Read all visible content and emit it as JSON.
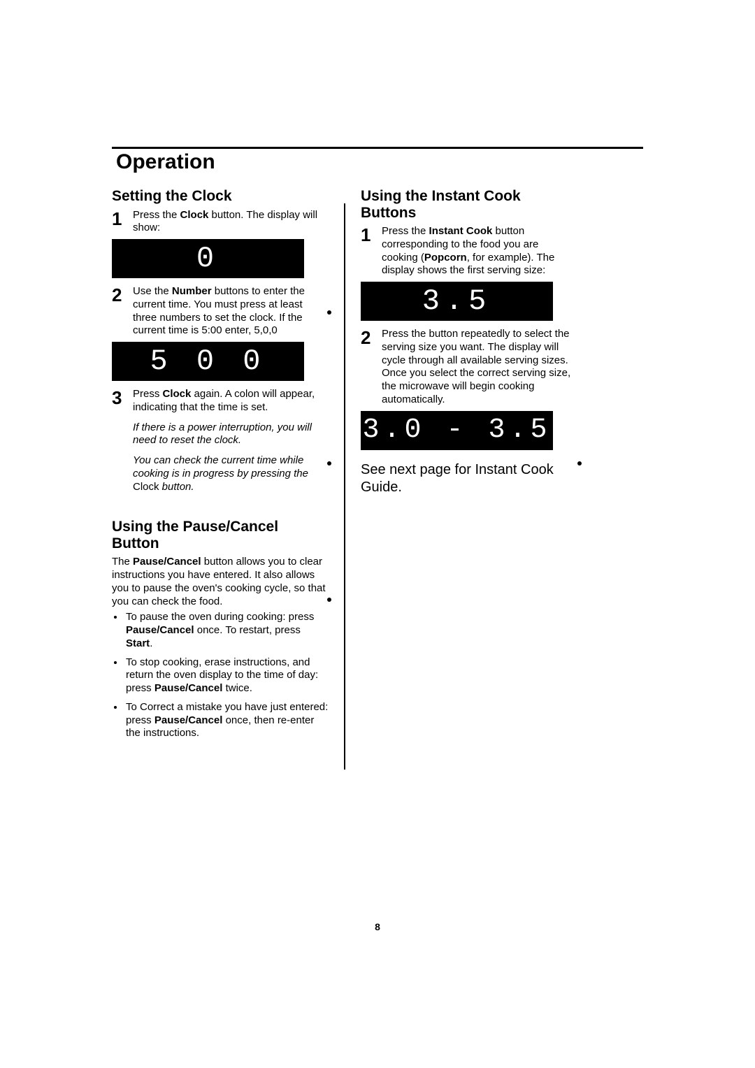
{
  "title": "Operation",
  "page_number": "8",
  "left": {
    "sec1_heading": "Setting the Clock",
    "step1_num": "1",
    "step1_a": "Press the ",
    "step1_clock": "Clock",
    "step1_b": " button. The display will show:",
    "display1": "0",
    "step2_num": "2",
    "step2_a": "Use the ",
    "step2_number": "Number",
    "step2_b": " buttons to enter the current time. You must press at least three numbers to set the clock. If the current time is 5:00 enter, 5,0,0",
    "display2": "5 0 0",
    "step3_num": "3",
    "step3_a": "Press ",
    "step3_clock": "Clock",
    "step3_b": " again. A colon will appear, indicating that the time is set.",
    "step3_note1": "If there is a power interruption, you will need to reset the clock.",
    "step3_note2": "You can check the current time while cooking is in progress by pressing the",
    "step3_note2_clock": "Clock",
    "step3_note2_tail": "  button.",
    "sec2_heading": "Using the Pause/Cancel Button",
    "sec2_intro_a": "The ",
    "sec2_intro_pc": "Pause/Cancel",
    "sec2_intro_b": " button allows you to clear instructions you have entered.  It also allows you to pause the oven's cooking cycle, so that you can check the food.",
    "bul1_a": "To pause the oven during cooking: press ",
    "bul1_pc": "Pause/Cancel",
    "bul1_b": " once. To restart, press ",
    "bul1_start": "Start",
    "bul1_c": ".",
    "bul2_a": "To stop cooking, erase instructions, and return the oven display to the time of day: press ",
    "bul2_pc": "Pause/Cancel",
    "bul2_b": " twice.",
    "bul3_a": "To Correct a mistake you have just entered: press ",
    "bul3_pc": "Pause/Cancel",
    "bul3_b": " once, then re-enter the instructions."
  },
  "right": {
    "sec_heading": "Using the Instant Cook Buttons",
    "step1_num": "1",
    "step1_a": "Press the ",
    "step1_ic": "Instant Cook",
    "step1_b": " button corresponding to the food you are cooking (",
    "step1_pop": "Popcorn",
    "step1_c": ", for example). The display shows the first serving size:",
    "display1": "3.5",
    "step2_num": "2",
    "step2_text": "Press the button repeatedly to select the serving size you want. The display will cycle through all available serving sizes. Once you select the correct serving size, the microwave will begin cooking automatically.",
    "display2": "3.0 - 3.5",
    "note": "See next page for Instant Cook Guide."
  }
}
